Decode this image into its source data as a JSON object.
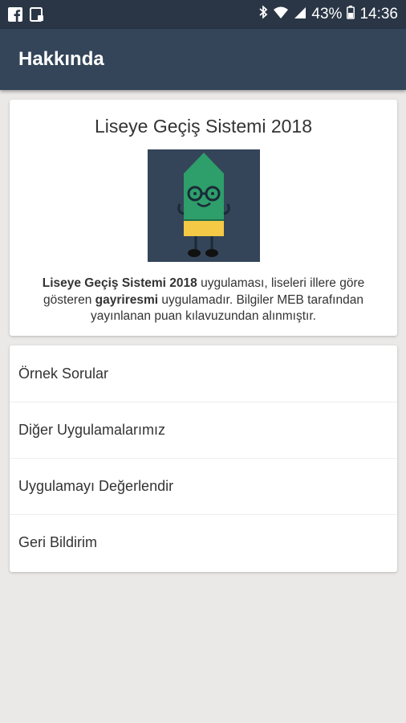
{
  "status_bar": {
    "battery": "43%",
    "time": "14:36",
    "icons": [
      "facebook-icon",
      "gallery-notification-icon",
      "bluetooth-icon",
      "wifi-icon",
      "signal-icon",
      "battery-icon"
    ]
  },
  "app_bar": {
    "title": "Hakkında"
  },
  "about": {
    "title": "Liseye Geçiş Sistemi 2018",
    "app_name_bold": "Liseye Geçiş Sistemi 2018",
    "desc_part1": " uygulaması, liseleri illere göre gösteren ",
    "unofficial_bold": "gayriresmi",
    "desc_part2": " uygulamadır. Bilgiler MEB tarafından yayınlanan puan kılavuzundan alınmıştır."
  },
  "menu": {
    "items": [
      {
        "label": "Örnek Sorular"
      },
      {
        "label": "Diğer Uygulamalarımız"
      },
      {
        "label": "Uygulamayı Değerlendir"
      },
      {
        "label": "Geri Bildirim"
      }
    ]
  },
  "colors": {
    "status_bar": "#2a3645",
    "app_bar": "#344559",
    "background": "#ebe9e7",
    "mascot_bg": "#344559",
    "mascot_green": "#2e9e6a",
    "mascot_yellow": "#f4c946"
  }
}
